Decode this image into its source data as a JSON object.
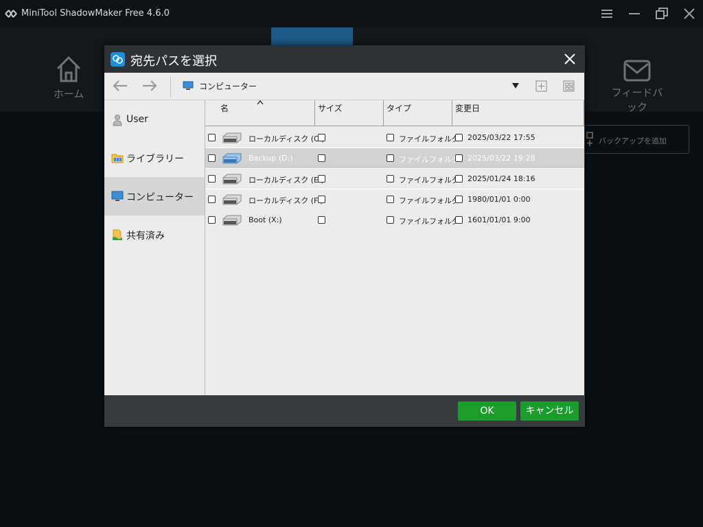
{
  "app": {
    "title": "MiniTool ShadowMaker Free 4.6.0",
    "nav": {
      "home_label": "ホーム",
      "feedback_label": "フィードバック"
    },
    "add_backup_label": "バックアップを追加"
  },
  "dialog": {
    "title": "宛先パスを選択",
    "toolbar": {
      "location": "コンピューター"
    },
    "sidebar": [
      {
        "label": "User",
        "icon": "user-icon"
      },
      {
        "label": "ライブラリー",
        "icon": "library-folder-icon"
      },
      {
        "label": "コンピューター",
        "icon": "computer-icon",
        "active": true
      },
      {
        "label": "共有済み",
        "icon": "shared-icon"
      }
    ],
    "columns": {
      "name": "名",
      "size": "サイズ",
      "type": "タイプ",
      "modified": "変更日"
    },
    "rows": [
      {
        "name": "ローカルディスク (C:)",
        "type": "ファイルフォルダ",
        "modified": "2025/03/22 17:55",
        "selected": false
      },
      {
        "name": "Backup (D:)",
        "type": "ファイルフォルダ",
        "modified": "2025/03/22 19:28",
        "selected": true
      },
      {
        "name": "ローカルディスク (E:)",
        "type": "ファイルフォルダ",
        "modified": "2025/01/24 18:16",
        "selected": false
      },
      {
        "name": "ローカルディスク (F:)",
        "type": "ファイルフォルダ",
        "modified": "1980/01/01 0:00",
        "selected": false
      },
      {
        "name": "Boot (X:)",
        "type": "ファイルフォルダ",
        "modified": "1601/01/01 9:00",
        "selected": false
      }
    ],
    "buttons": {
      "ok": "OK",
      "cancel": "キャンセル"
    }
  },
  "colors": {
    "accent_green": "#1c9d2b",
    "title_icon_blue": "#1e8ed8",
    "nav_active_blue": "#1d5a86"
  }
}
